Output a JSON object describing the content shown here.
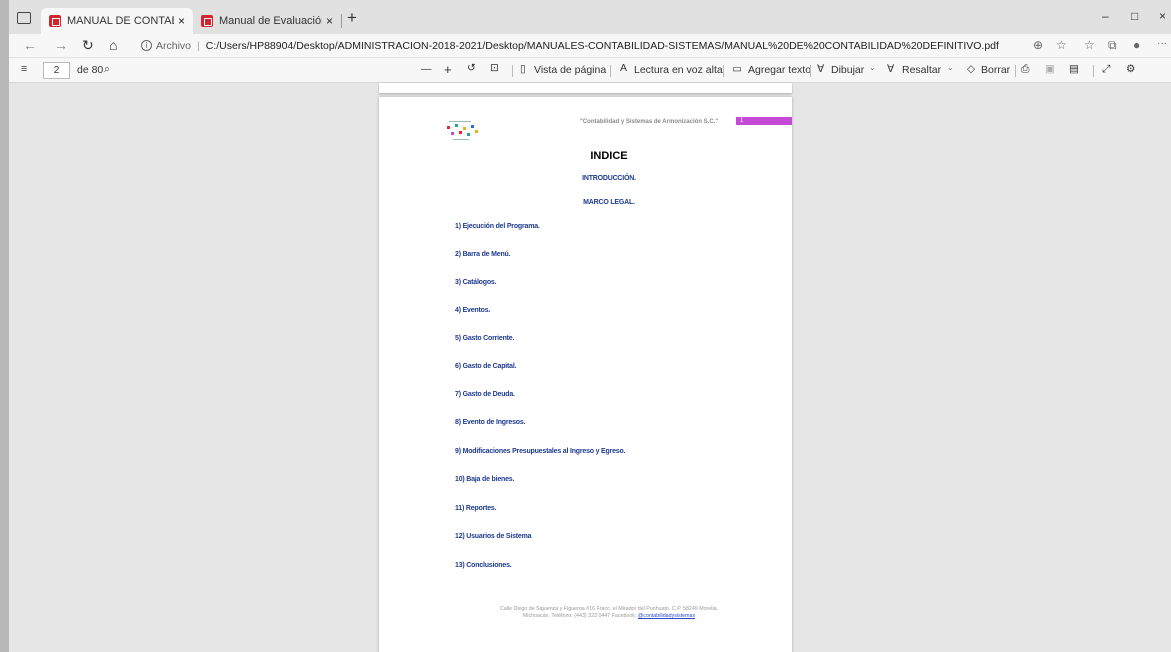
{
  "tabs": [
    {
      "title": "MANUAL DE CONTABILIDAD DE",
      "close": "×"
    },
    {
      "title": "Manual de Evaluación de Avanc",
      "close": "×"
    }
  ],
  "new_tab": "+",
  "window_controls": {
    "minimize": "–",
    "maximize": "□",
    "close": "×"
  },
  "address": {
    "info": "i",
    "label": "Archivo",
    "separator": "|",
    "url": "C:/Users/HP88904/Desktop/ADMINISTRACION-2018-2021/Desktop/MANUALES-CONTABILIDAD-SISTEMAS/MANUAL%20DE%20CONTABILIDAD%20DEFINITIVO.pdf",
    "more": "···"
  },
  "pdf_toolbar": {
    "page": "2",
    "of": "de 80",
    "zoom_out": "—",
    "zoom_in": "+",
    "page_view": "Vista de página",
    "read_aloud": "Lectura en voz alta",
    "add_text": "Agregar texto",
    "draw": "Dibujar",
    "highlight": "Resaltar",
    "erase": "Borrar"
  },
  "document": {
    "header_text": "\"Contabilidad y Sistemas de Armonización S.C.\"",
    "header_page": "1",
    "title": "INDICE",
    "intro": "INTRODUCCIÓN.",
    "marco": "MARCO LEGAL.",
    "items": [
      "1) Ejecución del Programa.",
      "2) Barra de Menú.",
      "3) Catálogos.",
      "4) Eventos.",
      "5) Gasto Corriente.",
      "6) Gasto de Capital.",
      "7) Gasto de Deuda.",
      "8) Evento de Ingresos.",
      "9) Modificaciones Presupuestales al Ingreso y Egreso.",
      "10) Baja de bienes.",
      "11) Reportes.",
      "12) Usuarios de Sistema",
      "13) Conclusiones."
    ],
    "footer_line1": "Calle Diego de Siguenza y Figueroa #16 Fracc. el Mirador del Punhuato. C.P. 58249 Morelia,",
    "footer_line2": "Michoacán. Teléfono: (443) 323 0447 Facebook:",
    "footer_link": "@contabilidadysistemas"
  },
  "colors": {
    "accent_bar": "#c44ad6",
    "toc_text": "#1f3b8f",
    "pdf_icon": "#d2262e"
  }
}
